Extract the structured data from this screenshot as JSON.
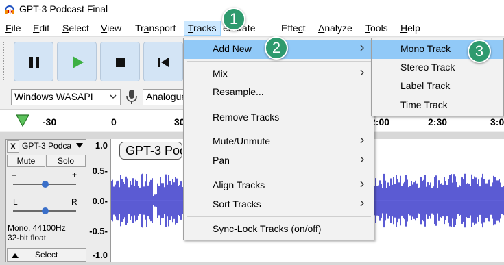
{
  "window": {
    "title": "GPT-3 Podcast Final"
  },
  "menubar": [
    {
      "label": "File",
      "key": "F",
      "rest": "ile"
    },
    {
      "label": "Edit",
      "key": "E",
      "rest": "dit"
    },
    {
      "label": "Select",
      "key": "S",
      "rest": "elect"
    },
    {
      "label": "View",
      "key": "V",
      "rest": "iew"
    },
    {
      "label": "Transport",
      "pre": "Tr",
      "key": "a",
      "rest": "nsport"
    },
    {
      "label": "Tracks",
      "key": "T",
      "rest": "racks"
    },
    {
      "label": "Generate",
      "pre": "",
      "key": "",
      "rest": "enerate"
    },
    {
      "label": "Effect",
      "pre": "Effe",
      "key": "c",
      "rest": "t"
    },
    {
      "label": "Analyze",
      "key": "A",
      "rest": "nalyze"
    },
    {
      "label": "Tools",
      "key": "T",
      "rest": "ools"
    },
    {
      "label": "Help",
      "key": "H",
      "rest": "elp"
    }
  ],
  "device_toolbar": {
    "host": "Windows WASAPI",
    "input": "Analogue"
  },
  "timeline": {
    "ticks": [
      "-30",
      "0",
      "30",
      "2:00",
      "2:30",
      "3:0"
    ]
  },
  "track": {
    "name": "GPT-3 Podca",
    "close": "X",
    "mute": "Mute",
    "solo": "Solo",
    "gain_minus": "–",
    "gain_plus": "+",
    "pan_left": "L",
    "pan_right": "R",
    "info_rate": "Mono, 44100Hz",
    "info_format": "32-bit float",
    "select": "Select",
    "tag": "GPT-3 Podcast Final",
    "scale": [
      "1.0",
      "0.5-",
      "0.0-",
      "-0.5-",
      "-1.0"
    ],
    "waveform_color": "#3232c8"
  },
  "tracks_menu": {
    "items": [
      {
        "label": "Add New",
        "submenu": true,
        "highlighted": true
      },
      {
        "label": "Mix",
        "submenu": true
      },
      {
        "label": "Resample...",
        "submenu": false
      },
      {
        "label": "Remove Tracks",
        "submenu": false
      },
      {
        "label": "Mute/Unmute",
        "submenu": true
      },
      {
        "label": "Pan",
        "submenu": true
      },
      {
        "label": "Align Tracks",
        "submenu": true
      },
      {
        "label": "Sort Tracks",
        "submenu": true
      },
      {
        "label": "Sync-Lock Tracks (on/off)",
        "submenu": false
      }
    ]
  },
  "add_new_submenu": {
    "items": [
      {
        "label": "Mono Track",
        "highlighted": true
      },
      {
        "label": "Stereo Track"
      },
      {
        "label": "Label Track"
      },
      {
        "label": "Time Track"
      }
    ]
  },
  "badges": [
    "1",
    "2",
    "3"
  ],
  "colors": {
    "accent": "#2e9a6e",
    "menu_highlight": "#91c9f7",
    "button_bg": "#d3e4f5",
    "play_green": "#3cb043"
  }
}
